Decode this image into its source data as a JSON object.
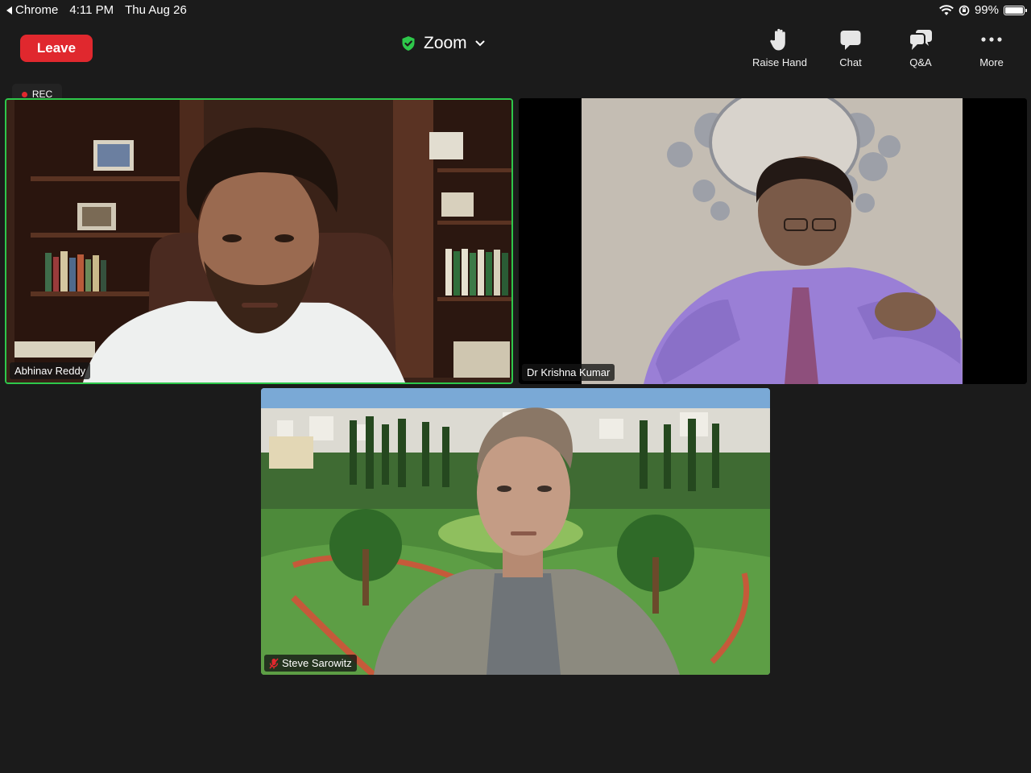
{
  "status_bar": {
    "back_app": "Chrome",
    "time": "4:11 PM",
    "date": "Thu Aug 26",
    "battery": "99%"
  },
  "toolbar": {
    "leave_label": "Leave",
    "meeting_title": "Zoom",
    "raise_hand_label": "Raise Hand",
    "chat_label": "Chat",
    "qa_label": "Q&A",
    "more_label": "More"
  },
  "recording": {
    "label": "REC"
  },
  "participants": [
    {
      "name": "Abhinav Reddy",
      "active_speaker": true,
      "muted": false
    },
    {
      "name": "Dr Krishna Kumar",
      "active_speaker": false,
      "muted": false
    },
    {
      "name": "Steve Sarowitz",
      "active_speaker": false,
      "muted": true
    }
  ],
  "colors": {
    "leave": "#e0282e",
    "active_border": "#2ec84b",
    "secure_shield": "#2ec84b",
    "background": "#1b1b1b"
  }
}
